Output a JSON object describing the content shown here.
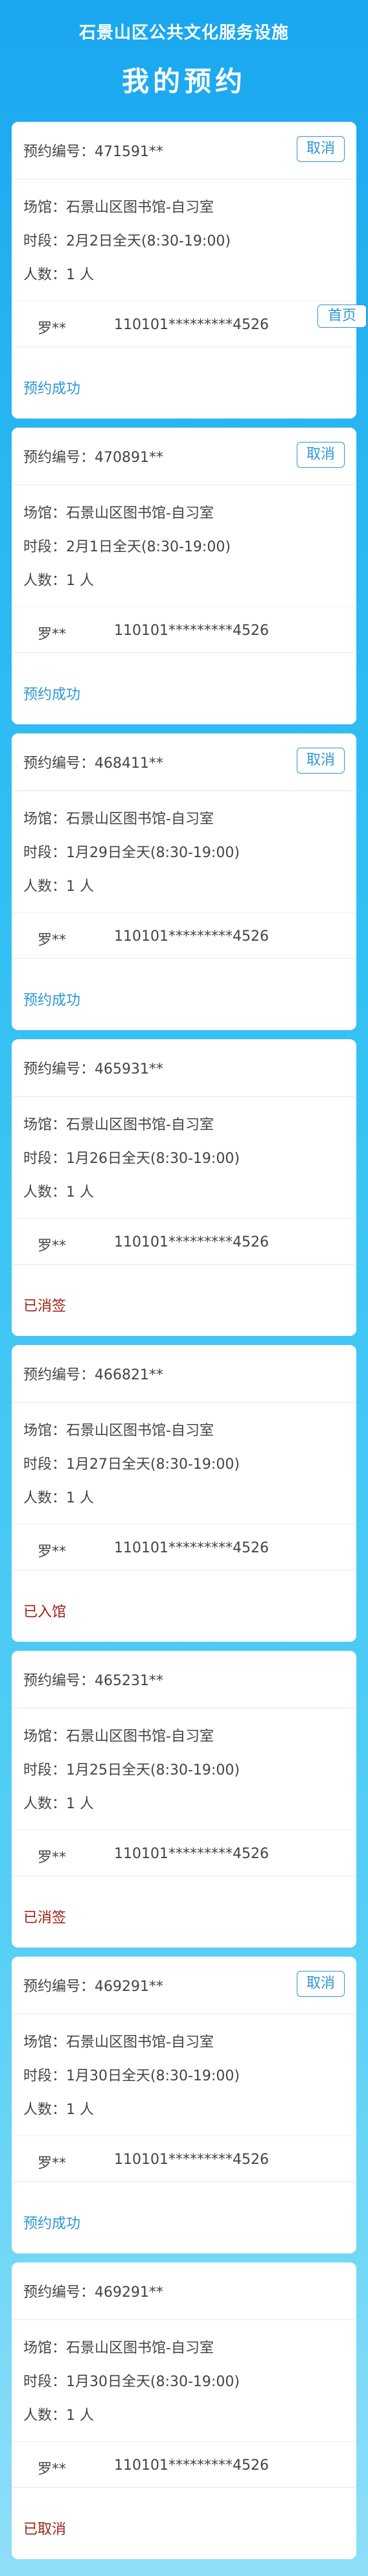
{
  "header": {
    "subtitle": "石景山区公共文化服务设施",
    "title": "我的预约"
  },
  "home_button": "首页",
  "labels": {
    "order_prefix": "预约编号：",
    "venue_prefix": "场馆：",
    "time_prefix": "时段：",
    "count_prefix": "人数：",
    "cancel": "取消"
  },
  "colors": {
    "accent": "#2c97d6",
    "status_ok": "#2c97d6",
    "status_bad": "#9e1f12"
  },
  "reservations": [
    {
      "order_no": "471591**",
      "venue": "石景山区图书馆-自习室",
      "time": "2月2日全天(8:30-19:00)",
      "count": "1 人",
      "person_name": "罗**",
      "person_id": "110101*********4526",
      "status": "预约成功",
      "status_kind": "ok",
      "cancelable": true
    },
    {
      "order_no": "470891**",
      "venue": "石景山区图书馆-自习室",
      "time": "2月1日全天(8:30-19:00)",
      "count": "1 人",
      "person_name": "罗**",
      "person_id": "110101*********4526",
      "status": "预约成功",
      "status_kind": "ok",
      "cancelable": true
    },
    {
      "order_no": "468411**",
      "venue": "石景山区图书馆-自习室",
      "time": "1月29日全天(8:30-19:00)",
      "count": "1 人",
      "person_name": "罗**",
      "person_id": "110101*********4526",
      "status": "预约成功",
      "status_kind": "ok",
      "cancelable": true
    },
    {
      "order_no": "465931**",
      "venue": "石景山区图书馆-自习室",
      "time": "1月26日全天(8:30-19:00)",
      "count": "1 人",
      "person_name": "罗**",
      "person_id": "110101*********4526",
      "status": "已消签",
      "status_kind": "bad",
      "cancelable": false
    },
    {
      "order_no": "466821**",
      "venue": "石景山区图书馆-自习室",
      "time": "1月27日全天(8:30-19:00)",
      "count": "1 人",
      "person_name": "罗**",
      "person_id": "110101*********4526",
      "status": "已入馆",
      "status_kind": "bad",
      "cancelable": false
    },
    {
      "order_no": "465231**",
      "venue": "石景山区图书馆-自习室",
      "time": "1月25日全天(8:30-19:00)",
      "count": "1 人",
      "person_name": "罗**",
      "person_id": "110101*********4526",
      "status": "已消签",
      "status_kind": "bad",
      "cancelable": false
    },
    {
      "order_no": "469291**",
      "venue": "石景山区图书馆-自习室",
      "time": "1月30日全天(8:30-19:00)",
      "count": "1 人",
      "person_name": "罗**",
      "person_id": "110101*********4526",
      "status": "预约成功",
      "status_kind": "ok",
      "cancelable": true
    },
    {
      "order_no": "469291**",
      "venue": "石景山区图书馆-自习室",
      "time": "1月30日全天(8:30-19:00)",
      "count": "1 人",
      "person_name": "罗**",
      "person_id": "110101*********4526",
      "status": "已取消",
      "status_kind": "bad",
      "cancelable": false
    }
  ]
}
